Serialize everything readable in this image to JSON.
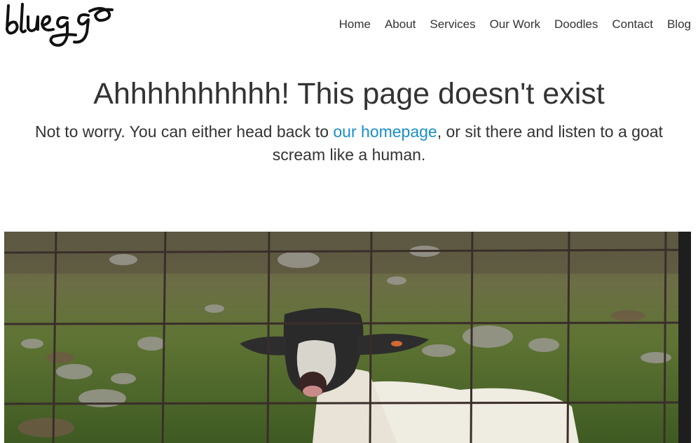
{
  "brand": {
    "name": "bluegg"
  },
  "nav": {
    "items": [
      "Home",
      "About",
      "Services",
      "Our Work",
      "Doodles",
      "Contact",
      "Blog"
    ]
  },
  "main": {
    "title": "Ahhhhhhhhhh! This page doesn't exist",
    "text_before": "Not to worry. You can either head back to ",
    "link_text": "our homepage",
    "text_after": ", or sit there and listen to a goat scream like a human."
  },
  "colors": {
    "link": "#1a8ec9",
    "text": "#333333"
  }
}
